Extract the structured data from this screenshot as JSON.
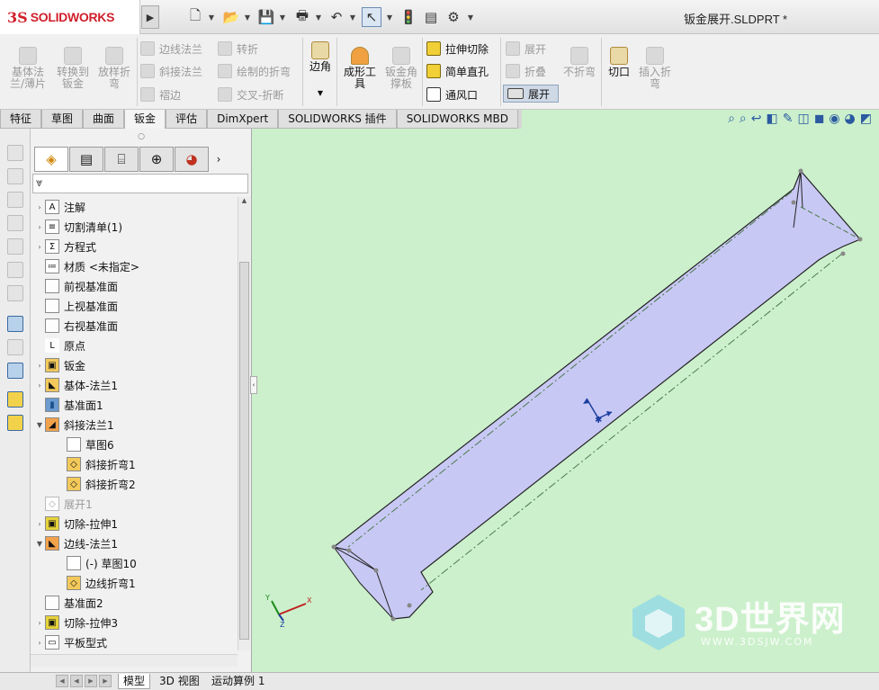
{
  "app": {
    "logo_prefix": "3S",
    "logo_name": "SOLIDWORKS",
    "doc_title": "钣金展开.SLDPRT *"
  },
  "quick_access": [
    "new-icon",
    "open-icon",
    "save-icon",
    "print-icon",
    "undo-icon",
    "select-icon",
    "rebuild-icon",
    "file-properties-icon",
    "options-icon"
  ],
  "ribbon": {
    "base_flange": "基体法\n兰/薄片",
    "convert_to_sheet": "转换到\n钣金",
    "lofted_bend": "放样折\n弯",
    "edge_flange": "边线法兰",
    "miter_flange": "斜接法兰",
    "hem": "褶边",
    "jog": "转折",
    "sketched_bend": "绘制的折弯",
    "cross_break": "交叉-折断",
    "corners": "边角",
    "forming_tool": "成形工\n具",
    "gusset": "钣金角\n撑板",
    "extruded_cut": "拉伸切除",
    "simple_hole": "简单直孔",
    "vent": "通风口",
    "unfold": "展开",
    "fold": "折叠",
    "flatten": "展开",
    "no_bends": "不折弯",
    "rip": "切口",
    "insert_bends": "插入折\n弯"
  },
  "tabs": [
    "特征",
    "草图",
    "曲面",
    "钣金",
    "评估",
    "DimXpert",
    "SOLIDWORKS 插件",
    "SOLIDWORKS MBD"
  ],
  "active_tab": "钣金",
  "panel_tabs": [
    "feature-manager-icon",
    "property-manager-icon",
    "configuration-manager-icon",
    "dimxpert-manager-icon",
    "display-manager-icon"
  ],
  "tree": [
    {
      "label": "注解",
      "icon": "A"
    },
    {
      "label": "切割清单(1)",
      "icon": "≡"
    },
    {
      "label": "方程式",
      "icon": "Σ"
    },
    {
      "label": "材质 <未指定>",
      "icon": "≔"
    },
    {
      "label": "前视基准面",
      "icon": ""
    },
    {
      "label": "上视基准面",
      "icon": ""
    },
    {
      "label": "右视基准面",
      "icon": ""
    },
    {
      "label": "原点",
      "icon": "L"
    },
    {
      "label": "钣金",
      "icon": "▣"
    },
    {
      "label": "基体-法兰1",
      "icon": "◣"
    },
    {
      "label": "基准面1",
      "icon": "▮"
    },
    {
      "label": "斜接法兰1",
      "icon": "◢"
    },
    {
      "label": "草图6",
      "icon": ""
    },
    {
      "label": "斜接折弯1",
      "icon": "◇"
    },
    {
      "label": "斜接折弯2",
      "icon": "◇"
    },
    {
      "label": "展开1",
      "icon": "◇"
    },
    {
      "label": "切除-拉伸1",
      "icon": "▣"
    },
    {
      "label": "边线-法兰1",
      "icon": "◣"
    },
    {
      "label": "(-) 草图10",
      "icon": ""
    },
    {
      "label": "边线折弯1",
      "icon": "◇"
    },
    {
      "label": "基准面2",
      "icon": ""
    },
    {
      "label": "切除-拉伸3",
      "icon": "▣"
    },
    {
      "label": "平板型式",
      "icon": "▭"
    }
  ],
  "bottom_tabs": [
    "模型",
    "3D 视图",
    "运动算例 1"
  ],
  "triad": {
    "x": "X",
    "y": "Y",
    "z": "Z"
  },
  "watermark": {
    "text": "3D世界网",
    "url": "WWW.3DSJW.COM"
  },
  "colors": {
    "viewport_bg": "#ccf0cc",
    "part_fill": "#c8c8f4",
    "accent_red": "#d0202c"
  }
}
